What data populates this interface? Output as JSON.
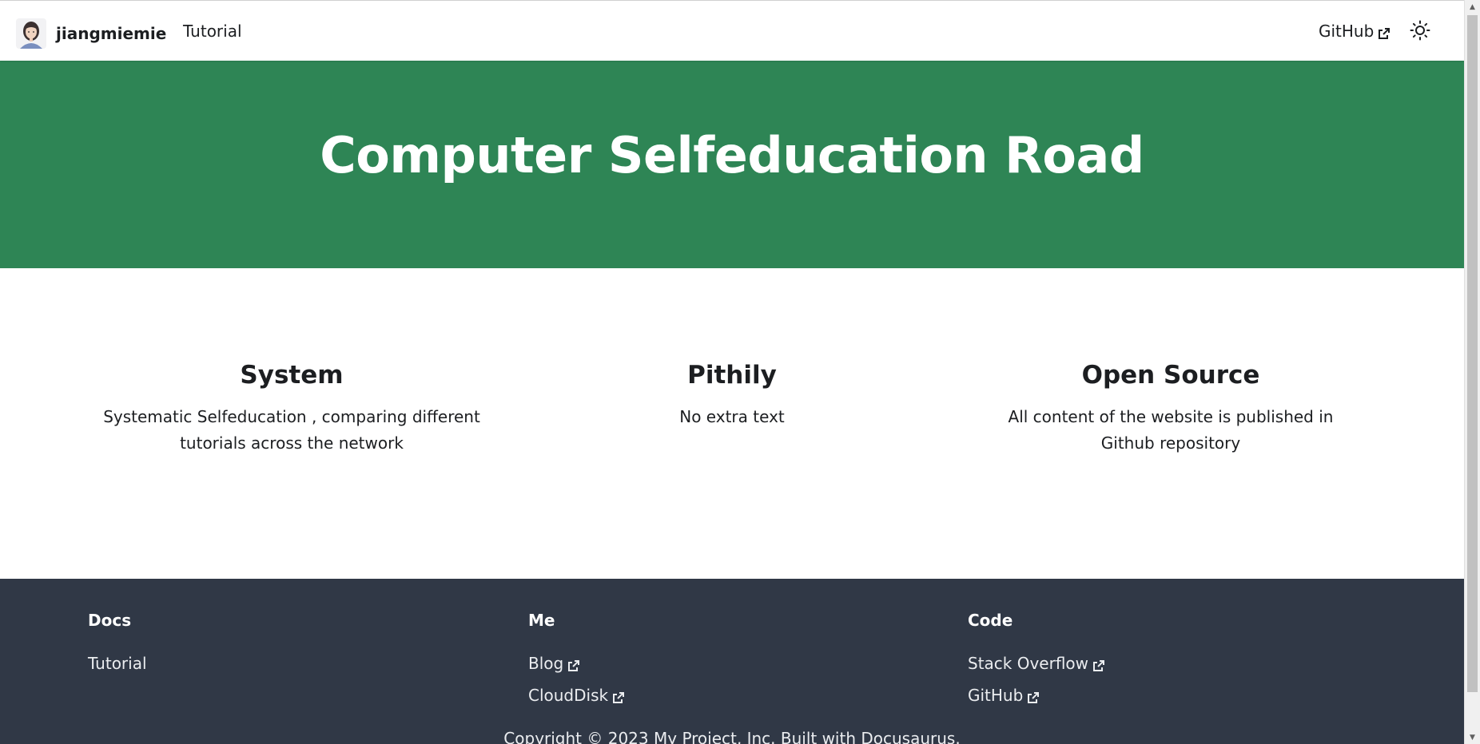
{
  "navbar": {
    "brand_title": "jiangmiemie",
    "links": {
      "tutorial": "Tutorial",
      "github": "GitHub"
    },
    "theme_icon": "sun-icon"
  },
  "hero": {
    "title": "Computer Selfeducation Road",
    "background_color": "#2e8555"
  },
  "features": [
    {
      "title": "System",
      "description": "Systematic Selfeducation , comparing different tutorials across the network"
    },
    {
      "title": "Pithily",
      "description": "No extra text"
    },
    {
      "title": "Open Source",
      "description": "All content of the website is published in Github repository"
    }
  ],
  "footer": {
    "background_color": "#303846",
    "columns": [
      {
        "heading": "Docs",
        "links": [
          {
            "label": "Tutorial",
            "external": false
          }
        ]
      },
      {
        "heading": "Me",
        "links": [
          {
            "label": "Blog",
            "external": true
          },
          {
            "label": "CloudDisk",
            "external": true
          }
        ]
      },
      {
        "heading": "Code",
        "links": [
          {
            "label": "Stack Overflow",
            "external": true
          },
          {
            "label": "GitHub",
            "external": true
          }
        ]
      }
    ],
    "copyright": "Copyright © 2023 My Project, Inc. Built with Docusaurus."
  }
}
